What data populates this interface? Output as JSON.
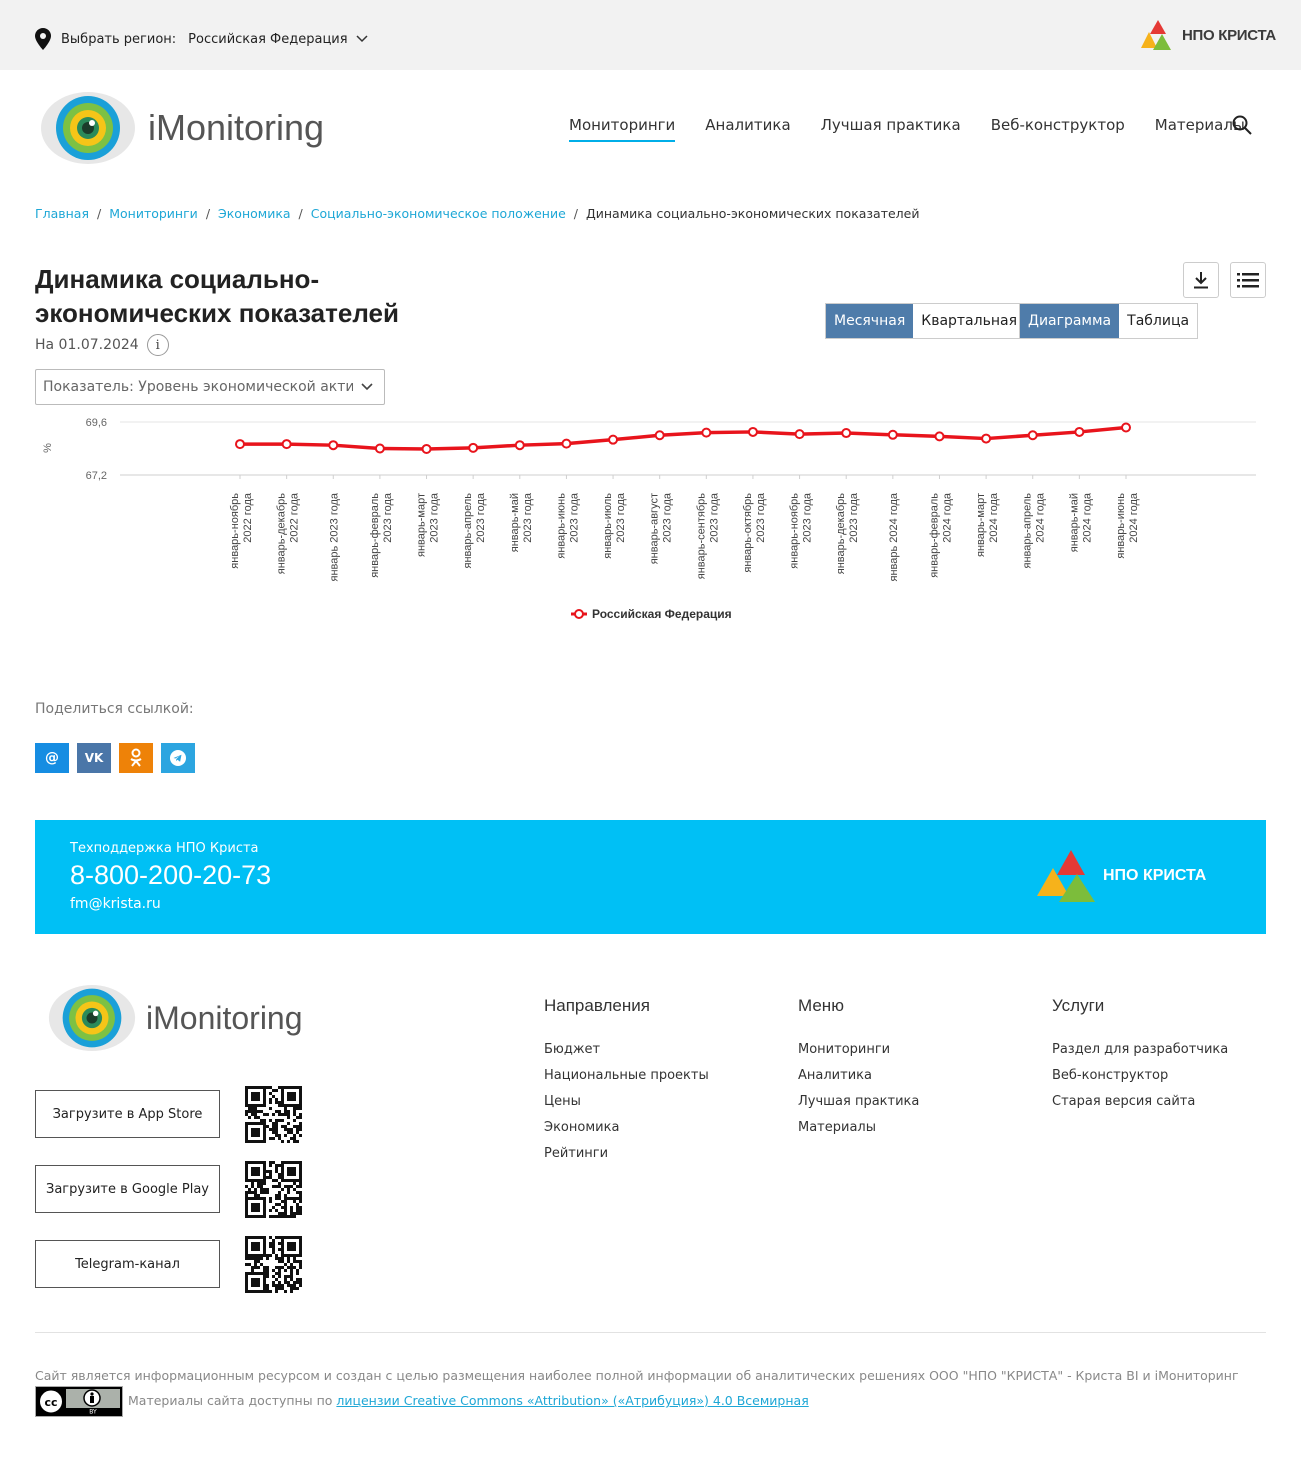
{
  "topbar": {
    "region_label": "Выбрать регион:",
    "region_value": "Российская Федерация",
    "partner_logo": "НПО КРИСТА"
  },
  "header": {
    "brand": "iMonitoring",
    "nav": [
      "Мониторинги",
      "Аналитика",
      "Лучшая практика",
      "Веб-конструктор",
      "Материалы"
    ],
    "active_nav": "Мониторинги"
  },
  "breadcrumb": {
    "items": [
      "Главная",
      "Мониторинги",
      "Экономика",
      "Социально-экономическое положение"
    ],
    "current": "Динамика социально-экономических показателей"
  },
  "page": {
    "title": "Динамика социально-экономических показателей",
    "date": "На 01.07.2024",
    "info_glyph": "i",
    "period_tabs": [
      "Месячная",
      "Квартальная"
    ],
    "period_active": "Месячная",
    "view_tabs": [
      "Диаграмма",
      "Таблица"
    ],
    "view_active": "Диаграмма",
    "indicator": "Показатель: Уровень экономической активности"
  },
  "chart_data": {
    "type": "line",
    "ylabel": "%",
    "yticks": [
      "69,6",
      "67,2"
    ],
    "ylim": [
      67.2,
      69.6
    ],
    "categories": [
      [
        "январь-ноябрь",
        "2022 года"
      ],
      [
        "январь-декабрь",
        "2022 года"
      ],
      [
        "январь 2023 года"
      ],
      [
        "январь-февраль",
        "2023 года"
      ],
      [
        "январь-март",
        "2023 года"
      ],
      [
        "январь-апрель",
        "2023 года"
      ],
      [
        "январь-май",
        "2023 года"
      ],
      [
        "январь-июнь",
        "2023 года"
      ],
      [
        "январь-июль",
        "2023 года"
      ],
      [
        "январь-август",
        "2023 года"
      ],
      [
        "январь-сентябрь",
        "2023 года"
      ],
      [
        "январь-октябрь",
        "2023 года"
      ],
      [
        "январь-ноябрь",
        "2023 года"
      ],
      [
        "январь-декабрь",
        "2023 года"
      ],
      [
        "январь 2024 года"
      ],
      [
        "январь-февраль",
        "2024 года"
      ],
      [
        "январь-март",
        "2024 года"
      ],
      [
        "январь-апрель",
        "2024 года"
      ],
      [
        "январь-май",
        "2024 года"
      ],
      [
        "январь-июнь",
        "2024 года"
      ]
    ],
    "series": [
      {
        "name": "Российская Федерация",
        "color": "#e8141c",
        "values": [
          68.6,
          68.6,
          68.55,
          68.4,
          68.38,
          68.43,
          68.55,
          68.62,
          68.8,
          69.0,
          69.12,
          69.15,
          69.05,
          69.1,
          69.02,
          68.95,
          68.85,
          69.0,
          69.15,
          69.35
        ]
      }
    ]
  },
  "share": {
    "label": "Поделиться ссылкой:",
    "buttons": [
      {
        "glyph": "@",
        "color": "#168de2"
      },
      {
        "glyph": "VK",
        "color": "#4a76a8"
      },
      {
        "glyph": "ok",
        "color": "#ee8208"
      },
      {
        "glyph": "tg",
        "color": "#2ca5e0"
      }
    ]
  },
  "support": {
    "label": "Техподдержка НПО Криста",
    "phone": "8-800-200-20-73",
    "email": "fm@krista.ru",
    "logo": "НПО КРИСТА"
  },
  "footer": {
    "brand": "iMonitoring",
    "app_buttons": [
      "Загрузите в App Store",
      "Загрузите в Google Play",
      "Telegram-канал"
    ],
    "columns": [
      {
        "title": "Направления",
        "links": [
          "Бюджет",
          "Национальные проекты",
          "Цены",
          "Экономика",
          "Рейтинги"
        ]
      },
      {
        "title": "Меню",
        "links": [
          "Мониторинги",
          "Аналитика",
          "Лучшая практика",
          "Материалы"
        ]
      },
      {
        "title": "Услуги",
        "links": [
          "Раздел для разработчика",
          "Веб-конструктор",
          "Старая версия сайта"
        ]
      }
    ],
    "disclaimer": "Сайт является информационным ресурсом и создан с целью размещения наиболее полной информации об аналитических решениях ООО \"НПО \"КРИСТА\" - Криста BI и iМониторинг",
    "license_prefix": "Материалы сайта доступны по ",
    "license_link": "лицензии Creative Commons «Attribution» («Атрибуция») 4.0 Всемирная",
    "cc_badge": "BY"
  }
}
